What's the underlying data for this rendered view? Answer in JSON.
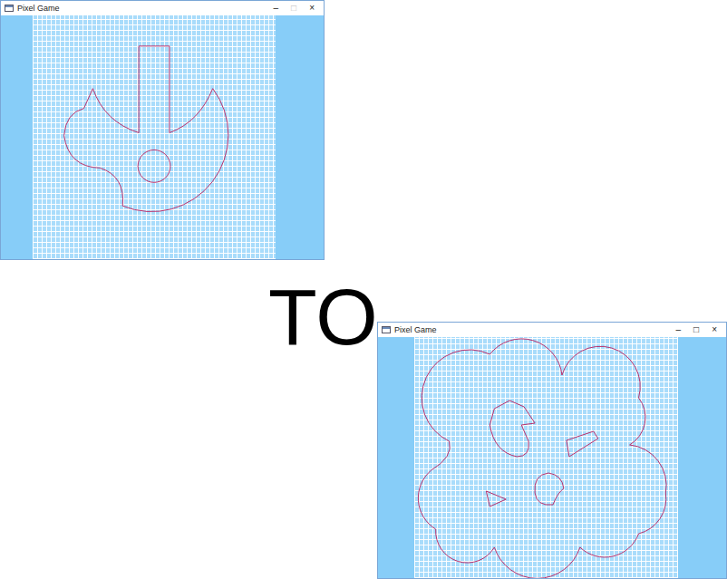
{
  "windows": [
    {
      "title": "Pixel Game",
      "controls": [
        {
          "label": "–",
          "disabled": false
        },
        {
          "label": "□",
          "disabled": true
        },
        {
          "label": "×",
          "disabled": false
        }
      ]
    },
    {
      "title": "Pixel Game",
      "controls": [
        {
          "label": "–",
          "disabled": false
        },
        {
          "label": "□",
          "disabled": false
        },
        {
          "label": "×",
          "disabled": false
        }
      ]
    }
  ],
  "caption": "TO"
}
